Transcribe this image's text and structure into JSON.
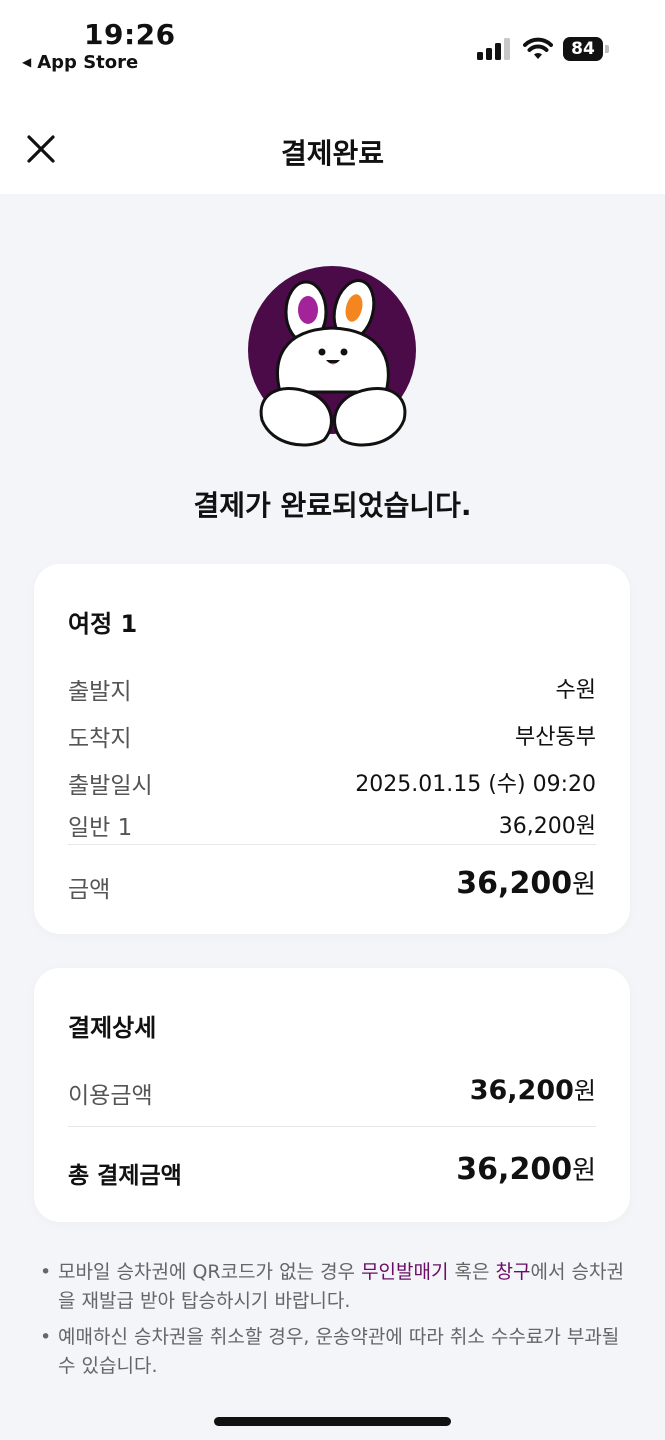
{
  "status_bar": {
    "time": "19:26",
    "back_app": "App Store",
    "battery": "84"
  },
  "nav": {
    "title": "결제완료",
    "close_icon": "close-icon"
  },
  "message": "결제가 완료되었습니다.",
  "trip_card": {
    "title": "여정 1",
    "rows": [
      {
        "label": "출발지",
        "value": "수원"
      },
      {
        "label": "도착지",
        "value": "부산동부"
      },
      {
        "label": "출발일시",
        "value": "2025.01.15 (수) 09:20"
      },
      {
        "label": "일반 1",
        "value": "36,200원"
      }
    ],
    "amount_label": "금액",
    "amount_value": "36,200",
    "amount_unit": "원"
  },
  "payment_card": {
    "title": "결제상세",
    "usage_label": "이용금액",
    "usage_value": "36,200",
    "usage_unit": "원",
    "total_label": "총 결제금액",
    "total_value": "36,200",
    "total_unit": "원"
  },
  "notes": {
    "note1_pre": "모바일 승차권에 QR코드가 없는 경우 ",
    "note1_hl1": "무인발매기",
    "note1_mid": " 혹은 ",
    "note1_hl2": "창구",
    "note1_post": "에서 승차권을 재발급 받아 탑승하시기 바랍니다.",
    "note2": "예매하신 승차권을 취소할 경우, 운송약관에 따라 취소 수수료가 부과될 수 있습니다."
  },
  "colors": {
    "accent": "#6a0d66",
    "mascot_bg": "#4b0a48",
    "ear_left": "#a3239b",
    "ear_right": "#f5851f",
    "page_bg": "#f4f5f9"
  }
}
